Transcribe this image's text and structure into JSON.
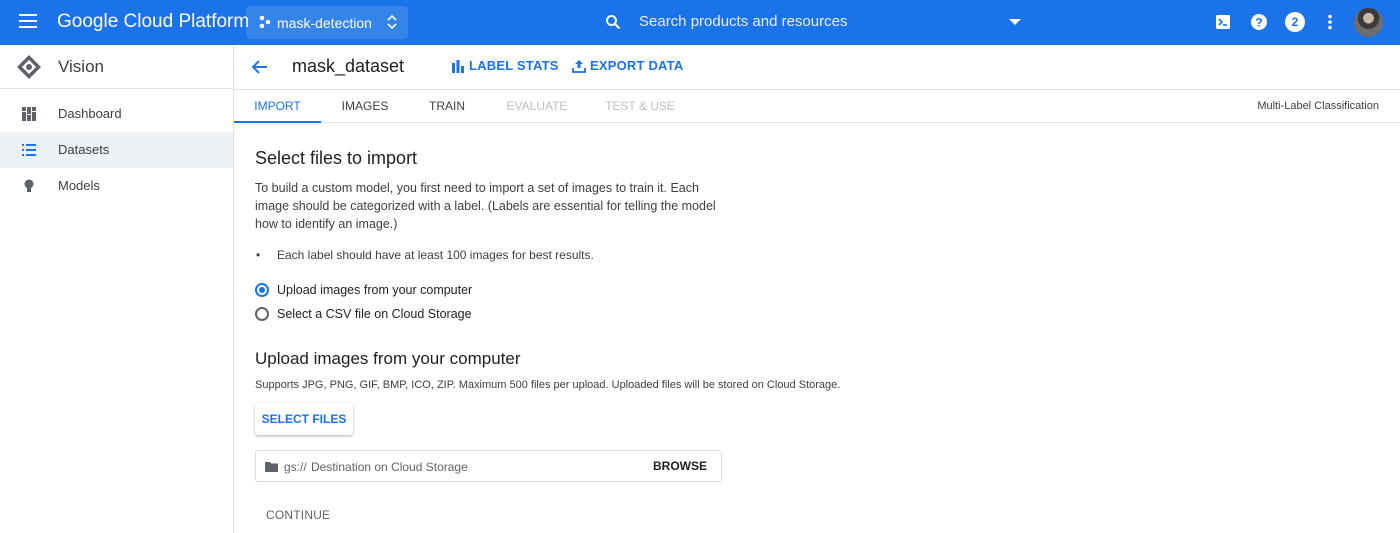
{
  "topbar": {
    "brand": "Google Cloud Platform",
    "project": "mask-detection",
    "search_placeholder": "Search products and resources",
    "notification_count": "2",
    "accent": "#1a73e8"
  },
  "sidebar": {
    "title": "Vision",
    "items": [
      {
        "label": "Dashboard",
        "icon": "dashboard-icon"
      },
      {
        "label": "Datasets",
        "icon": "list-icon",
        "active": true
      },
      {
        "label": "Models",
        "icon": "lightbulb-icon"
      }
    ]
  },
  "header": {
    "dataset_name": "mask_dataset",
    "label_stats": "LABEL STATS",
    "export_data": "EXPORT DATA"
  },
  "tabs": [
    {
      "label": "IMPORT",
      "state": "active"
    },
    {
      "label": "IMAGES",
      "state": "normal"
    },
    {
      "label": "TRAIN",
      "state": "normal"
    },
    {
      "label": "EVALUATE",
      "state": "disabled"
    },
    {
      "label": "TEST & USE",
      "state": "disabled"
    }
  ],
  "model_type": "Multi-Label Classification",
  "main": {
    "title": "Select files to import",
    "description": "To build a custom model, you first need to import a set of images to train it. Each image should be categorized with a label. (Labels are essential for telling the model how to identify an image.)",
    "bullet": "Each label should have at least 100 images for best results.",
    "radio_options": [
      {
        "label": "Upload images from your computer",
        "selected": true
      },
      {
        "label": "Select a CSV file on Cloud Storage",
        "selected": false
      }
    ],
    "upload_title": "Upload images from your computer",
    "supports": "Supports JPG, PNG, GIF, BMP, ICO, ZIP. Maximum 500 files per upload. Uploaded files will be stored on Cloud Storage.",
    "select_files": "SELECT FILES",
    "gs_prefix": "gs://",
    "gs_placeholder": "Destination on Cloud Storage",
    "browse": "BROWSE",
    "continue": "CONTINUE"
  }
}
